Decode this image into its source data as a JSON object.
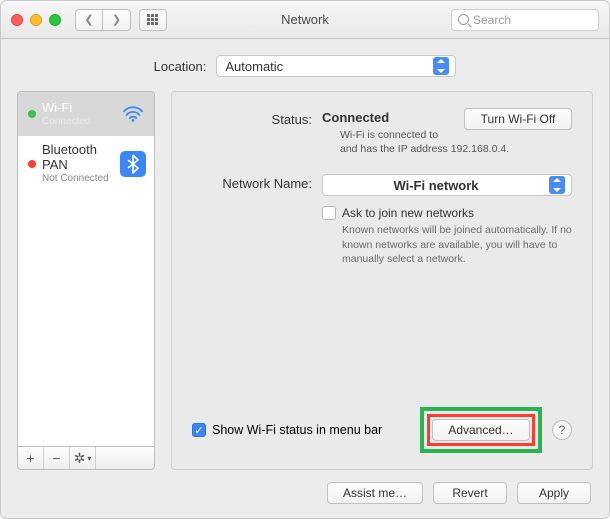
{
  "window": {
    "title": "Network"
  },
  "search": {
    "placeholder": "Search"
  },
  "location": {
    "label": "Location:",
    "value": "Automatic"
  },
  "sidebar": {
    "items": [
      {
        "name": "Wi-Fi",
        "status": "Connected"
      },
      {
        "name": "Bluetooth PAN",
        "status": "Not Connected"
      }
    ]
  },
  "detail": {
    "status_label": "Status:",
    "status_value": "Connected",
    "wifi_off_btn": "Turn Wi-Fi Off",
    "status_desc1": "Wi-Fi is connected to",
    "status_desc2": "and has the IP address 192.168.0.4.",
    "network_label": "Network Name:",
    "network_value": "Wi-Fi network",
    "ask_join": "Ask to join new networks",
    "ask_note": "Known networks will be joined automatically. If no known networks are available, you will have to manually select a network.",
    "show_menu": "Show Wi-Fi status in menu bar",
    "advanced": "Advanced…"
  },
  "footer": {
    "assist": "Assist me…",
    "revert": "Revert",
    "apply": "Apply"
  }
}
